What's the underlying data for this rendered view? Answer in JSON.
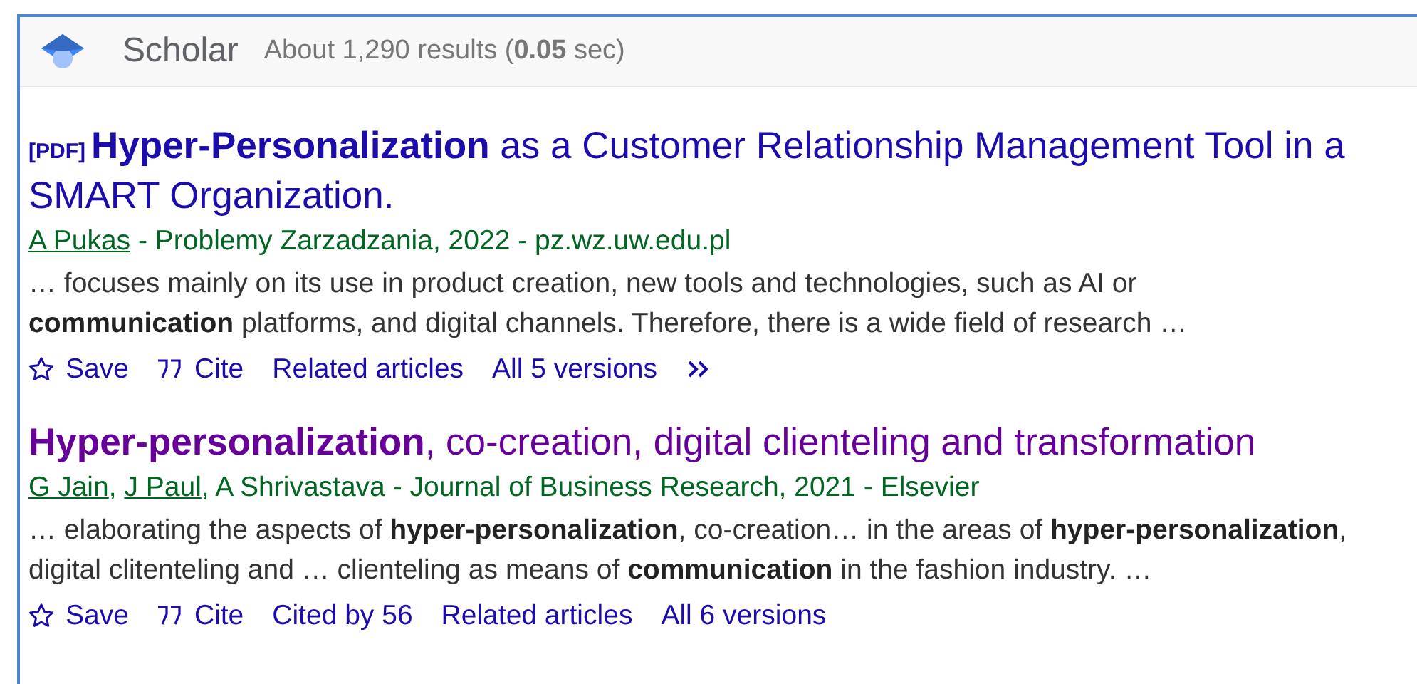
{
  "header": {
    "logo_text": "Scholar",
    "results": "About 1,290 results (**0.05** sec)"
  },
  "results": [
    {
      "tag": "[PDF]",
      "title": "**Hyper-Personalization** as a Customer Relationship Management Tool in a SMART Organization.",
      "visited": false,
      "authors": [
        {
          "name": "A Pukas",
          "linked": true
        }
      ],
      "source": " - Problemy Zarzadzania, 2022 - pz.wz.uw.edu.pl",
      "snippet_lines": [
        "… focuses mainly on its use in product creation, new tools and technologies, such as AI or",
        "**communication** platforms, and digital channels. Therefore, there is a wide field of research …"
      ],
      "actions": [
        {
          "kind": "save",
          "label": "Save"
        },
        {
          "kind": "cite",
          "label": "Cite"
        },
        {
          "kind": "link",
          "label": "Related articles"
        },
        {
          "kind": "link",
          "label": "All 5 versions"
        },
        {
          "kind": "more"
        }
      ]
    },
    {
      "title": "**Hyper-personalization**, co-creation, digital clienteling and transformation",
      "visited": true,
      "authors": [
        {
          "name": "G Jain",
          "linked": true
        },
        {
          "name": "J Paul",
          "linked": true
        },
        {
          "name": "A Shrivastava",
          "linked": false
        }
      ],
      "author_separator": ", ",
      "source": " - Journal of Business Research, 2021 - Elsevier",
      "snippet_lines": [
        "… elaborating the aspects of **hyper-personalization**, co-creation… in the areas of **hyper-personalization**,",
        "digital clitenteling and … clienteling as means of **communication** in the fashion industry. …"
      ],
      "actions": [
        {
          "kind": "save",
          "label": "Save"
        },
        {
          "kind": "cite",
          "label": "Cite"
        },
        {
          "kind": "link",
          "label": "Cited by 56"
        },
        {
          "kind": "link",
          "label": "Related articles"
        },
        {
          "kind": "link",
          "label": "All 6 versions"
        }
      ]
    }
  ]
}
